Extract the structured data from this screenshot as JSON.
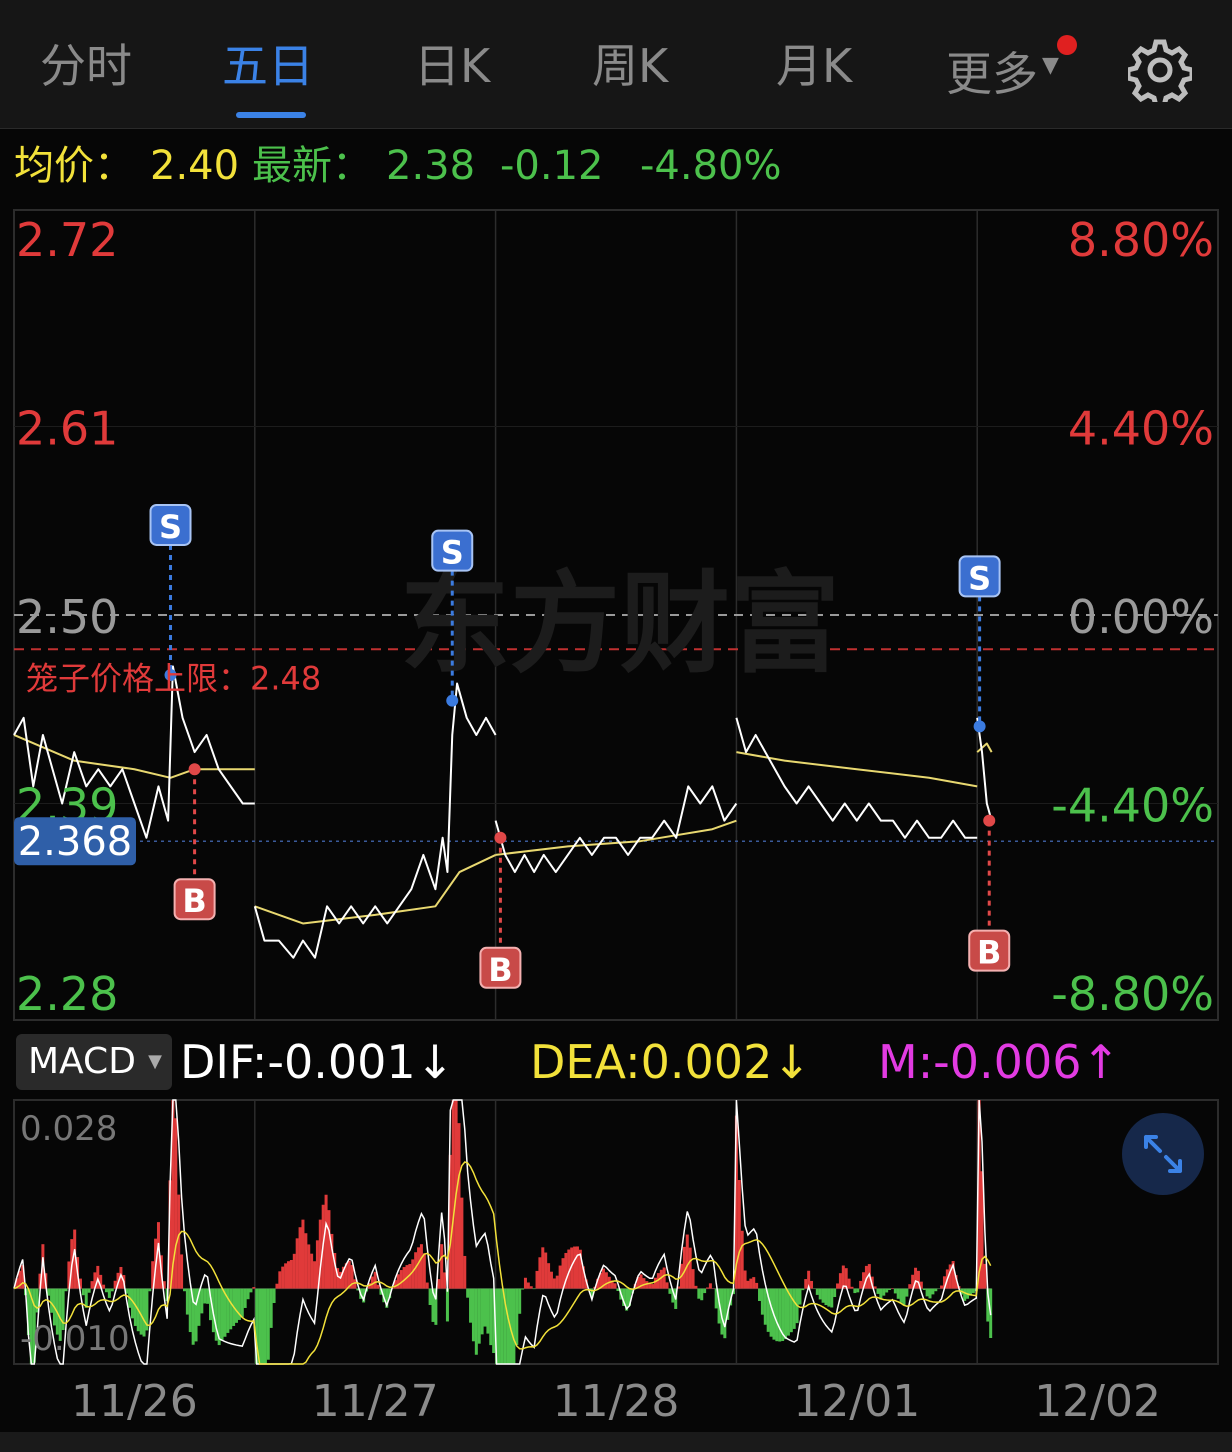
{
  "tabs": [
    {
      "label": "分时",
      "active": false
    },
    {
      "label": "五日",
      "active": true
    },
    {
      "label": "日K",
      "active": false
    },
    {
      "label": "周K",
      "active": false
    },
    {
      "label": "月K",
      "active": false
    },
    {
      "label": "更多",
      "active": false
    }
  ],
  "settings_icon": "gear-icon",
  "info": {
    "avg_label": "均价：",
    "avg_value": "2.40",
    "latest_label": "最新：",
    "latest_value": "2.38",
    "change": "-0.12",
    "change_pct": "-4.80%"
  },
  "colors": {
    "up": "#e03a3a",
    "down": "#4cc14c",
    "price_line": "#ffffff",
    "avg_line": "#e8d870",
    "active_tab": "#3b82e6",
    "dea": "#f2e13a",
    "m": "#e23be2"
  },
  "chart_data": {
    "type": "line",
    "title": "",
    "x_days": [
      "11/26",
      "11/27",
      "11/28",
      "12/01",
      "12/02"
    ],
    "ylim": [
      2.28,
      2.72
    ],
    "y_ticks_left": [
      "2.72",
      "2.61",
      "2.50",
      "2.39",
      "2.28"
    ],
    "y_ticks_right": [
      "8.80%",
      "4.40%",
      "0.00%",
      "-4.40%",
      "-8.80%"
    ],
    "prev_close": 2.5,
    "current_price_label": "2.368",
    "current_price": 2.368,
    "limit_line": {
      "label": "笼子价格上限：2.48",
      "value": 2.48
    },
    "watermark": "东方财富",
    "trade_marks": [
      {
        "type": "S",
        "day_pos": 0.65,
        "price": 2.465
      },
      {
        "type": "B",
        "day_pos": 0.75,
        "price": 2.41
      },
      {
        "type": "S",
        "day_pos": 1.82,
        "price": 2.45
      },
      {
        "type": "B",
        "day_pos": 2.02,
        "price": 2.37
      },
      {
        "type": "S",
        "day_pos": 4.01,
        "price": 2.435
      },
      {
        "type": "B",
        "day_pos": 4.05,
        "price": 2.38
      }
    ],
    "series": [
      {
        "name": "price",
        "points": [
          [
            0.0,
            2.43
          ],
          [
            0.04,
            2.44
          ],
          [
            0.08,
            2.4
          ],
          [
            0.12,
            2.43
          ],
          [
            0.16,
            2.41
          ],
          [
            0.2,
            2.39
          ],
          [
            0.25,
            2.42
          ],
          [
            0.3,
            2.4
          ],
          [
            0.35,
            2.41
          ],
          [
            0.4,
            2.4
          ],
          [
            0.45,
            2.41
          ],
          [
            0.5,
            2.39
          ],
          [
            0.55,
            2.37
          ],
          [
            0.6,
            2.4
          ],
          [
            0.64,
            2.38
          ],
          [
            0.66,
            2.47
          ],
          [
            0.7,
            2.44
          ],
          [
            0.75,
            2.42
          ],
          [
            0.8,
            2.43
          ],
          [
            0.85,
            2.41
          ],
          [
            0.9,
            2.4
          ],
          [
            0.95,
            2.39
          ],
          [
            1.0,
            2.39
          ],
          [
            1.0,
            2.33
          ],
          [
            1.04,
            2.31
          ],
          [
            1.1,
            2.31
          ],
          [
            1.16,
            2.3
          ],
          [
            1.2,
            2.31
          ],
          [
            1.25,
            2.3
          ],
          [
            1.3,
            2.33
          ],
          [
            1.35,
            2.32
          ],
          [
            1.4,
            2.33
          ],
          [
            1.45,
            2.32
          ],
          [
            1.5,
            2.33
          ],
          [
            1.55,
            2.32
          ],
          [
            1.6,
            2.33
          ],
          [
            1.65,
            2.34
          ],
          [
            1.7,
            2.36
          ],
          [
            1.75,
            2.34
          ],
          [
            1.78,
            2.37
          ],
          [
            1.8,
            2.35
          ],
          [
            1.82,
            2.43
          ],
          [
            1.84,
            2.46
          ],
          [
            1.88,
            2.44
          ],
          [
            1.92,
            2.43
          ],
          [
            1.96,
            2.44
          ],
          [
            2.0,
            2.43
          ],
          [
            2.0,
            2.38
          ],
          [
            2.04,
            2.36
          ],
          [
            2.08,
            2.35
          ],
          [
            2.12,
            2.36
          ],
          [
            2.16,
            2.35
          ],
          [
            2.2,
            2.36
          ],
          [
            2.25,
            2.35
          ],
          [
            2.3,
            2.36
          ],
          [
            2.35,
            2.37
          ],
          [
            2.4,
            2.36
          ],
          [
            2.45,
            2.37
          ],
          [
            2.5,
            2.37
          ],
          [
            2.55,
            2.36
          ],
          [
            2.6,
            2.37
          ],
          [
            2.65,
            2.37
          ],
          [
            2.7,
            2.38
          ],
          [
            2.75,
            2.37
          ],
          [
            2.8,
            2.4
          ],
          [
            2.85,
            2.39
          ],
          [
            2.9,
            2.4
          ],
          [
            2.95,
            2.38
          ],
          [
            3.0,
            2.39
          ],
          [
            3.0,
            2.44
          ],
          [
            3.04,
            2.42
          ],
          [
            3.08,
            2.43
          ],
          [
            3.12,
            2.42
          ],
          [
            3.16,
            2.41
          ],
          [
            3.2,
            2.4
          ],
          [
            3.25,
            2.39
          ],
          [
            3.3,
            2.4
          ],
          [
            3.35,
            2.39
          ],
          [
            3.4,
            2.38
          ],
          [
            3.45,
            2.39
          ],
          [
            3.5,
            2.38
          ],
          [
            3.55,
            2.39
          ],
          [
            3.6,
            2.38
          ],
          [
            3.65,
            2.38
          ],
          [
            3.7,
            2.37
          ],
          [
            3.75,
            2.38
          ],
          [
            3.8,
            2.37
          ],
          [
            3.85,
            2.37
          ],
          [
            3.9,
            2.38
          ],
          [
            3.95,
            2.37
          ],
          [
            4.0,
            2.37
          ],
          [
            4.0,
            2.44
          ],
          [
            4.02,
            2.42
          ],
          [
            4.04,
            2.39
          ],
          [
            4.06,
            2.38
          ]
        ]
      },
      {
        "name": "avg",
        "points": [
          [
            0.0,
            2.43
          ],
          [
            0.25,
            2.415
          ],
          [
            0.5,
            2.41
          ],
          [
            0.65,
            2.405
          ],
          [
            0.75,
            2.41
          ],
          [
            1.0,
            2.41
          ],
          [
            1.0,
            2.33
          ],
          [
            1.2,
            2.32
          ],
          [
            1.5,
            2.325
          ],
          [
            1.75,
            2.33
          ],
          [
            1.85,
            2.35
          ],
          [
            2.0,
            2.36
          ],
          [
            2.0,
            2.36
          ],
          [
            2.3,
            2.365
          ],
          [
            2.6,
            2.368
          ],
          [
            2.9,
            2.375
          ],
          [
            3.0,
            2.38
          ],
          [
            3.0,
            2.42
          ],
          [
            3.2,
            2.415
          ],
          [
            3.5,
            2.41
          ],
          [
            3.8,
            2.405
          ],
          [
            4.0,
            2.4
          ],
          [
            4.0,
            2.42
          ],
          [
            4.04,
            2.425
          ],
          [
            4.06,
            2.42
          ]
        ]
      }
    ]
  },
  "macd": {
    "selector_label": "MACD",
    "dif_label": "DIF:-0.001",
    "dif_arrow": "↓",
    "dea_label": "DEA:0.002",
    "dea_arrow": "↓",
    "m_label": "M:-0.006",
    "m_arrow": "↑",
    "y_top_label": "0.028",
    "y_bottom_label": "-0.010",
    "ylim": [
      -0.012,
      0.03
    ]
  },
  "expand_icon": "expand-icon"
}
